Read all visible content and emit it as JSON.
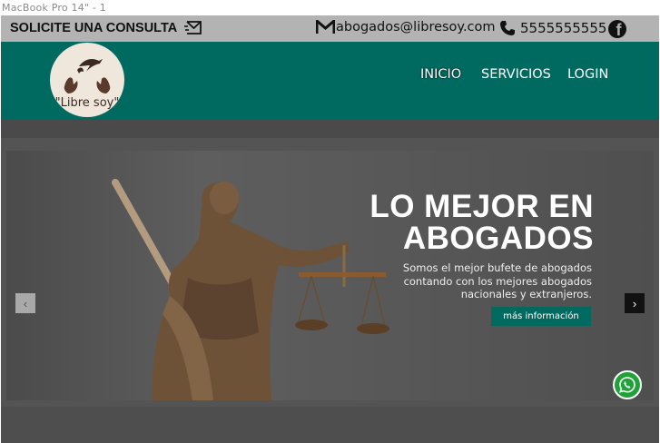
{
  "frame": {
    "label": "MacBook Pro 14\" - 1"
  },
  "topbar": {
    "consult_label": "SOLICITE UNA CONSULTA",
    "email": "abogados@libresoy.com",
    "phone": "5555555555"
  },
  "navbar": {
    "logo_text": "\"Libre soy\"",
    "links": [
      "INICIO",
      "SERVICIOS",
      "LOGIN"
    ]
  },
  "hero": {
    "title_line1": "LO MEJOR EN",
    "title_line2": "ABOGADOS",
    "subtitle_line1": "Somos el mejor bufete de abogados",
    "subtitle_line2": "contando con los mejores abogados",
    "subtitle_line3": "nacionales y extranjeros.",
    "button_label": "más información",
    "prev_glyph": "‹",
    "next_glyph": "›"
  },
  "colors": {
    "brand_teal": "#006a60",
    "topbar_gray": "#b3b3b3",
    "whatsapp_green": "#1fa339"
  },
  "icons": [
    "send-mail-icon",
    "gmail-icon",
    "phone-icon",
    "facebook-icon",
    "swallow-hands-logo-icon",
    "whatsapp-icon",
    "chevron-left-icon",
    "chevron-right-icon"
  ]
}
